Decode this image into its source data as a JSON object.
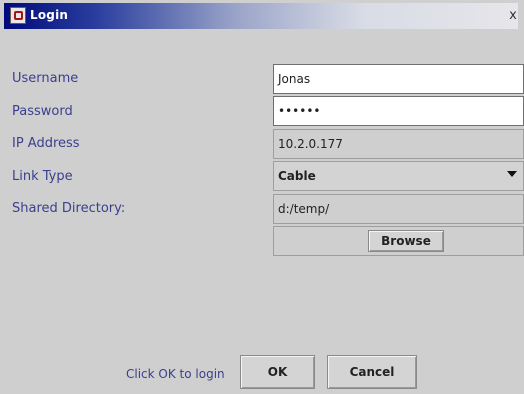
{
  "window": {
    "title": "Login",
    "close_symbol": "x"
  },
  "form": {
    "username": {
      "label": "Username",
      "value": "Jonas"
    },
    "password": {
      "label": "Password",
      "value": "••••••"
    },
    "ip_address": {
      "label": "IP Address",
      "value": "10.2.0.177"
    },
    "link_type": {
      "label": "Link Type",
      "value": "Cable"
    },
    "shared_directory": {
      "label": "Shared Directory:",
      "value": "d:/temp/"
    },
    "browse_label": "Browse"
  },
  "footer": {
    "hint": "Click OK to login",
    "ok_label": "OK",
    "cancel_label": "Cancel"
  },
  "colors": {
    "label": "#3a3f8e",
    "titlebar": "#000a7a"
  }
}
